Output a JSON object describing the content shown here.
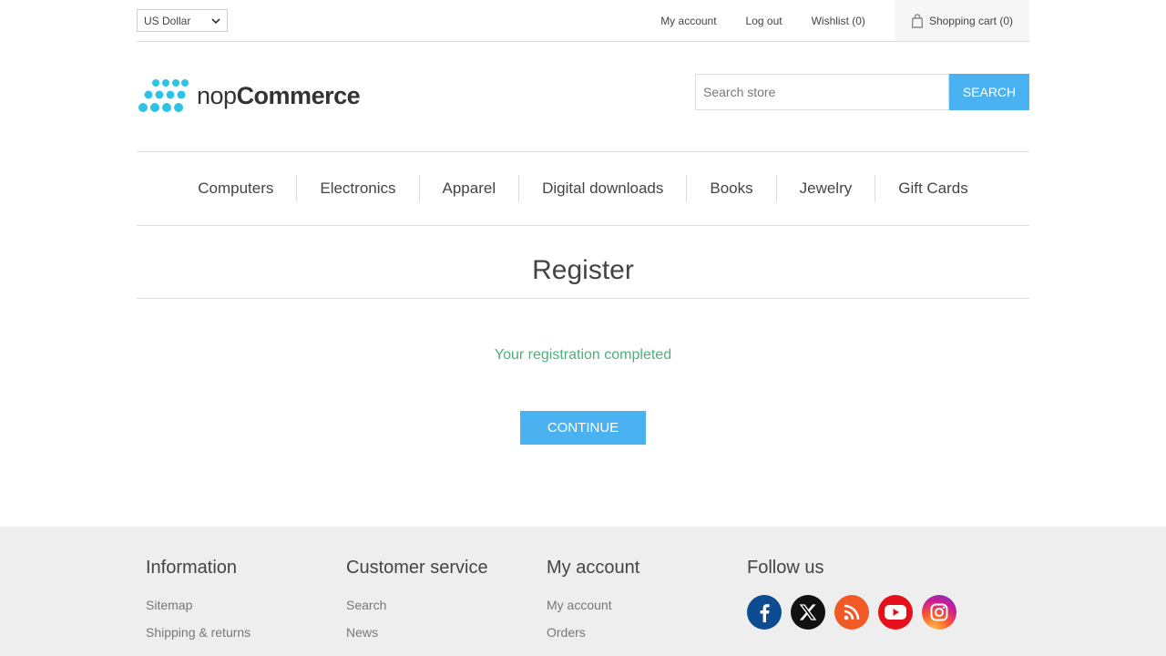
{
  "header": {
    "currency": "US Dollar",
    "links": {
      "my_account": "My account",
      "log_out": "Log out",
      "wishlist": "Wishlist (0)",
      "shopping_cart": "Shopping cart (0)"
    }
  },
  "logo": {
    "text_light": "nop",
    "text_bold": "Commerce",
    "dot_color": "#2ec3e6"
  },
  "search": {
    "placeholder": "Search store",
    "button": "Search"
  },
  "menu": {
    "items": [
      "Computers",
      "Electronics",
      "Apparel",
      "Digital downloads",
      "Books",
      "Jewelry",
      "Gift Cards"
    ]
  },
  "page": {
    "title": "Register",
    "result": "Your registration completed",
    "continue": "Continue"
  },
  "footer": {
    "information": {
      "title": "Information",
      "links": [
        "Sitemap",
        "Shipping & returns"
      ]
    },
    "customer_service": {
      "title": "Customer service",
      "links": [
        "Search",
        "News"
      ]
    },
    "my_account": {
      "title": "My account",
      "links": [
        "My account",
        "Orders"
      ]
    },
    "follow_us": {
      "title": "Follow us",
      "icons": [
        "facebook-icon",
        "x-icon",
        "rss-icon",
        "youtube-icon",
        "instagram-icon"
      ]
    }
  },
  "colors": {
    "accent": "#4ab2f1",
    "success": "#4cb17c",
    "footer_bg": "#eeeeee"
  }
}
